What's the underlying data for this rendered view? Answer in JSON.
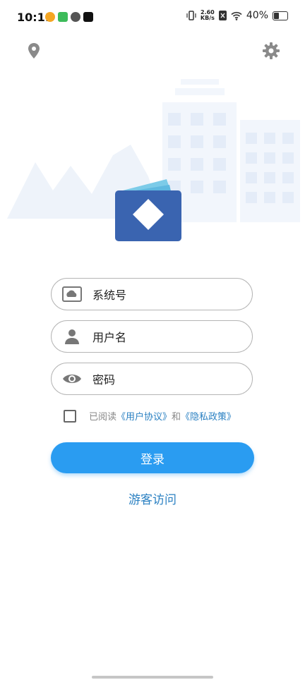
{
  "status_bar": {
    "time": "10:11",
    "net_speed_value": "2.60",
    "net_speed_unit": "KB/s",
    "battery": "40%"
  },
  "icons": {
    "top_left": "location-pin-icon",
    "top_right": "gear-icon"
  },
  "form": {
    "system_no_label": "系统号",
    "username_label": "用户名",
    "password_label": "密码"
  },
  "agreement": {
    "prefix": "已阅读",
    "user_agreement": "《用户协议》",
    "and": "和",
    "privacy_policy": "《隐私政策》",
    "checked": false
  },
  "buttons": {
    "login": "登录",
    "guest": "游客访问"
  },
  "colors": {
    "accent": "#2a9cf1",
    "link": "#2a80c2",
    "logo_front": "#3a64b0",
    "logo_back": "#5fb9e0"
  }
}
